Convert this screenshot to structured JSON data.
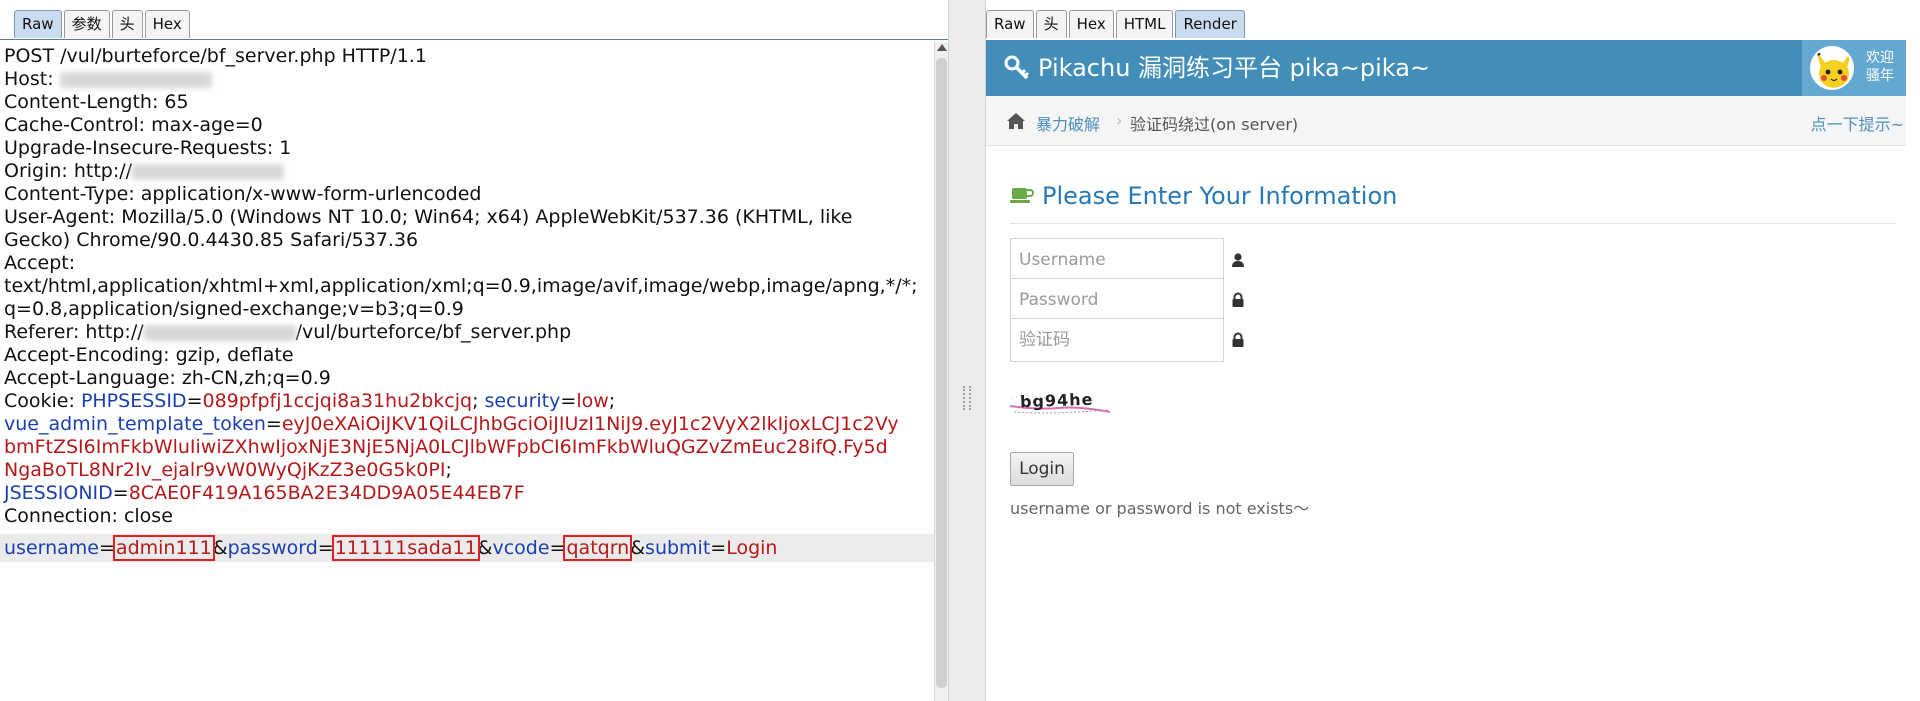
{
  "left_tabs": [
    "Raw",
    "参数",
    "头",
    "Hex"
  ],
  "right_tabs": [
    "Raw",
    "头",
    "Hex",
    "HTML",
    "Render"
  ],
  "request": {
    "request_line": "POST /vul/burteforce/bf_server.php HTTP/1.1",
    "host_label": "Host: ",
    "content_length": "Content-Length: 65",
    "cache_control": "Cache-Control: max-age=0",
    "upgrade": "Upgrade-Insecure-Requests: 1",
    "origin_label": "Origin: http://",
    "content_type": "Content-Type: application/x-www-form-urlencoded",
    "user_agent_1": "User-Agent: Mozilla/5.0 (Windows NT 10.0; Win64; x64) AppleWebKit/537.36 (KHTML, like",
    "user_agent_2": "Gecko) Chrome/90.0.4430.85 Safari/537.36",
    "accept_label": "Accept:",
    "accept_1": "text/html,application/xhtml+xml,application/xml;q=0.9,image/avif,image/webp,image/apng,*/*;",
    "accept_2": "q=0.8,application/signed-exchange;v=b3;q=0.9",
    "referer_label": "Referer: http://",
    "referer_path": "/vul/burteforce/bf_server.php",
    "accept_encoding": "Accept-Encoding: gzip, deflate",
    "accept_language": "Accept-Language: zh-CN,zh;q=0.9",
    "cookie_label": "Cookie: ",
    "cookie_phpsessid_key": "PHPSESSID",
    "cookie_phpsessid_val": "089pfpfj1ccjqi8a31hu2bkcjq",
    "cookie_security_key": "security",
    "cookie_security_val": "low",
    "vue_token_key": "vue_admin_template_token",
    "vue_token_val_1": "eyJ0eXAiOiJKV1QiLCJhbGciOiJIUzI1NiJ9.eyJ1c2VyX2lkIjoxLCJ1c2Vy",
    "vue_token_val_2": "bmFtZSI6ImFkbWluIiwiZXhwIjoxNjE3NjE5NjA0LCJlbWFpbCI6ImFkbWluQGZvZmEuc28ifQ.Fy5d",
    "vue_token_val_3": "NgaBoTL8Nr2Iv_ejalr9vW0WyQjKzZ3e0G5k0PI",
    "jsession_key": "JSESSIONID",
    "jsession_val": "8CAE0F419A165BA2E34DD9A05E44EB7F",
    "connection": "Connection: close",
    "body": {
      "username_key": "username",
      "username_val": "admin111",
      "password_key": "password",
      "password_val": "111111sada11",
      "vcode_key": "vcode",
      "vcode_val": "qatqrn",
      "submit_key": "submit",
      "submit_val": "Login"
    }
  },
  "render": {
    "brand": "Pikachu 漏洞练习平台 pika~pika~",
    "greeting": "欢迎骚年",
    "breadcrumb_parent": "暴力破解",
    "breadcrumb_current": "验证码绕过(on server)",
    "hint_link": "点一下提示~",
    "page_title": "Please Enter Your Information",
    "username_placeholder": "Username",
    "password_placeholder": "Password",
    "vcode_placeholder": "验证码",
    "captcha_text": "bg94he",
    "login_label": "Login",
    "status_message": "username or password is not exists～"
  },
  "colors": {
    "header_blue": "#438eb9",
    "link_blue": "#4c8fbd",
    "param_key": "#1a3fb0",
    "param_value": "#b51919",
    "highlight_box": "#e02020"
  },
  "icons": [
    "key-icon",
    "home-icon",
    "coffee-icon",
    "user-icon",
    "lock-icon",
    "pikachu-avatar"
  ]
}
